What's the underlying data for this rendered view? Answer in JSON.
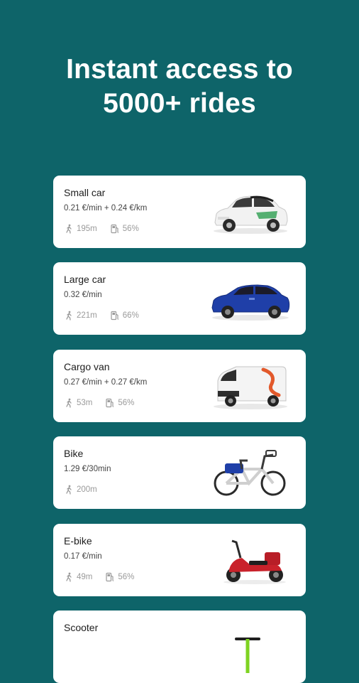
{
  "header": {
    "line1": "Instant access to",
    "line2": "5000+ rides"
  },
  "cards": [
    {
      "title": "Small car",
      "price": "0.21 €/min + 0.24 €/km",
      "distance": "195m",
      "fuel": "56%",
      "icon": "small-car-image"
    },
    {
      "title": "Large car",
      "price": "0.32 €/min",
      "distance": "221m",
      "fuel": "66%",
      "icon": "large-car-image"
    },
    {
      "title": "Cargo van",
      "price": "0.27 €/min + 0.27 €/km",
      "distance": "53m",
      "fuel": "56%",
      "icon": "cargo-van-image"
    },
    {
      "title": "Bike",
      "price": "1.29 €/30min",
      "distance": "200m",
      "icon": "bike-image"
    },
    {
      "title": "E-bike",
      "price": "0.17 €/min",
      "distance": "49m",
      "fuel": "56%",
      "icon": "e-bike-image"
    },
    {
      "title": "Scooter",
      "icon": "scooter-image"
    }
  ],
  "colors": {
    "background": "#0e6469",
    "card": "#ffffff",
    "text": "#1d1d1d",
    "muted": "#9a9a9a"
  }
}
